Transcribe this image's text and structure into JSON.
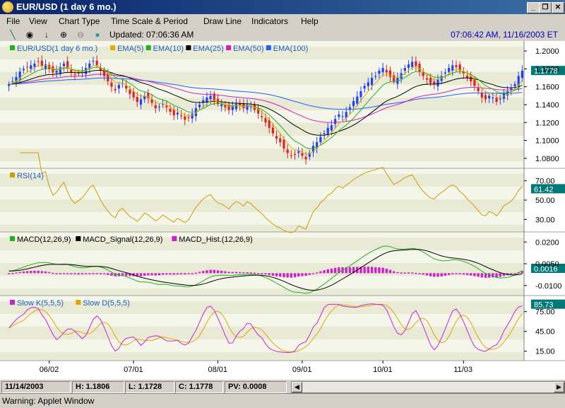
{
  "window": {
    "title": "EUR/USD (1 day  6 mo.)",
    "min": "_",
    "max": "❐",
    "close": "✕"
  },
  "menu": [
    "File",
    "View",
    "Chart Type",
    "Time Scale & Period",
    "Draw Line",
    "Indicators",
    "Help"
  ],
  "toolbar": {
    "tools": [
      "line-tool-icon",
      "crosshair-icon",
      "down-arrow-icon",
      "zoom-in-icon",
      "zoom-out-icon",
      "refresh-icon"
    ],
    "updated": "Updated: 07:06:36 AM",
    "clock": "07:06:42 AM, 11/16/2003 ET"
  },
  "colors": {
    "ema5": "#e0b000",
    "ema10": "#20b020",
    "ema25": "#000000",
    "ema50": "#d020c0",
    "ema100": "#2060ff",
    "up": "#2040ff",
    "down": "#e02020",
    "rsi": "#c8a000",
    "macd": "#20b020",
    "signal": "#000000",
    "hist": "#cc22cc",
    "slowk": "#cc22cc",
    "slowd": "#e0a800",
    "tag": "#007878"
  },
  "chart_data": [
    {
      "type": "candlestick",
      "legend": [
        "EUR/USD(1 day  6 mo.)",
        "EMA(5)",
        "EMA(10)",
        "EMA(25)",
        "EMA(50)",
        "EMA(100)"
      ],
      "y_ticks": [
        "1.2000",
        "1.1800",
        "1.1600",
        "1.1400",
        "1.1200",
        "1.1000",
        "1.0800"
      ],
      "ylim": [
        1.072,
        1.208
      ],
      "last_value": "1.1778",
      "close_series": [
        1.163,
        1.166,
        1.171,
        1.177,
        1.18,
        1.182,
        1.184,
        1.186,
        1.188,
        1.183,
        1.185,
        1.18,
        1.176,
        1.178,
        1.182,
        1.186,
        1.181,
        1.176,
        1.173,
        1.175,
        1.177,
        1.181,
        1.186,
        1.189,
        1.184,
        1.178,
        1.172,
        1.166,
        1.16,
        1.156,
        1.162,
        1.164,
        1.158,
        1.152,
        1.148,
        1.143,
        1.146,
        1.15,
        1.147,
        1.142,
        1.136,
        1.138,
        1.141,
        1.137,
        1.132,
        1.128,
        1.131,
        1.127,
        1.123,
        1.125,
        1.13,
        1.136,
        1.14,
        1.145,
        1.148,
        1.15,
        1.145,
        1.141,
        1.14,
        1.137,
        1.134,
        1.138,
        1.141,
        1.139,
        1.136,
        1.14,
        1.138,
        1.134,
        1.13,
        1.126,
        1.12,
        1.114,
        1.108,
        1.102,
        1.098,
        1.091,
        1.086,
        1.083,
        1.084,
        1.088,
        1.083,
        1.079,
        1.086,
        1.094,
        1.098,
        1.104,
        1.108,
        1.114,
        1.117,
        1.124,
        1.129,
        1.127,
        1.132,
        1.137,
        1.144,
        1.149,
        1.155,
        1.161,
        1.165,
        1.17,
        1.172,
        1.178,
        1.181,
        1.176,
        1.171,
        1.166,
        1.17,
        1.175,
        1.181,
        1.185,
        1.188,
        1.183,
        1.177,
        1.172,
        1.168,
        1.164,
        1.163,
        1.168,
        1.172,
        1.176,
        1.181,
        1.184,
        1.182,
        1.178,
        1.175,
        1.17,
        1.166,
        1.161,
        1.155,
        1.148,
        1.146,
        1.15,
        1.148,
        1.143,
        1.147,
        1.153,
        1.155,
        1.158,
        1.163,
        1.172,
        1.178
      ]
    },
    {
      "type": "line",
      "legend": [
        "RSI(14)"
      ],
      "y_ticks": [
        "70.00",
        "50.00",
        "30.00"
      ],
      "ylim": [
        20,
        80
      ],
      "last_value": "61.42"
    },
    {
      "type": "line",
      "legend": [
        "MACD(12,26,9)",
        "MACD_Signal(12,26,9)",
        "MACD_Hist.(12,26,9)"
      ],
      "y_ticks": [
        "0.0200",
        "0.0050",
        "-0.0100"
      ],
      "ylim": [
        -0.015,
        0.025
      ],
      "last_value": "0.0016"
    },
    {
      "type": "line",
      "legend": [
        "Slow K(5,5,5)",
        "Slow D(5,5,5)"
      ],
      "y_ticks": [
        "75.00",
        "45.00",
        "15.00"
      ],
      "ylim": [
        5,
        95
      ],
      "last_value": "85.73"
    }
  ],
  "x_ticks": [
    "06/02",
    "07/01",
    "08/01",
    "09/01",
    "10/01",
    "11/03"
  ],
  "status": {
    "date": "11/14/2003",
    "high": "H: 1.1806",
    "low": "L: 1.1728",
    "close": "C: 1.1778",
    "pv": "PV: 0.0008"
  },
  "warning": "Warning: Applet Window"
}
